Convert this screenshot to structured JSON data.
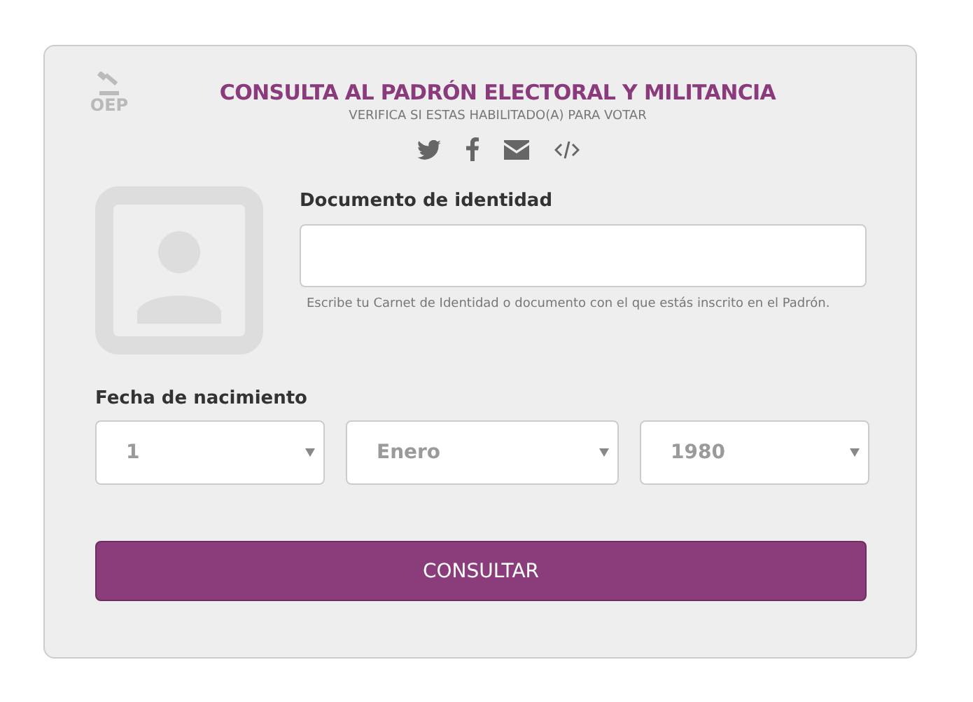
{
  "header": {
    "logo_text": "OEP",
    "title": "CONSULTA AL PADRÓN ELECTORAL Y MILITANCIA",
    "subtitle": "VERIFICA SI ESTAS HABILITADO(A) PARA VOTAR"
  },
  "share_icons": [
    {
      "kind": "twitter"
    },
    {
      "kind": "facebook"
    },
    {
      "kind": "email"
    },
    {
      "kind": "embed"
    }
  ],
  "document": {
    "label": "Documento de identidad",
    "hint": "Escribe tu Carnet de Identidad o documento con el que estás inscrito en el Padrón."
  },
  "birth_date": {
    "label": "Fecha de nacimiento",
    "selects": [
      {
        "value": "1"
      },
      {
        "value": "Enero"
      },
      {
        "value": "1980"
      }
    ]
  },
  "submit_button": "CONSULTAR"
}
